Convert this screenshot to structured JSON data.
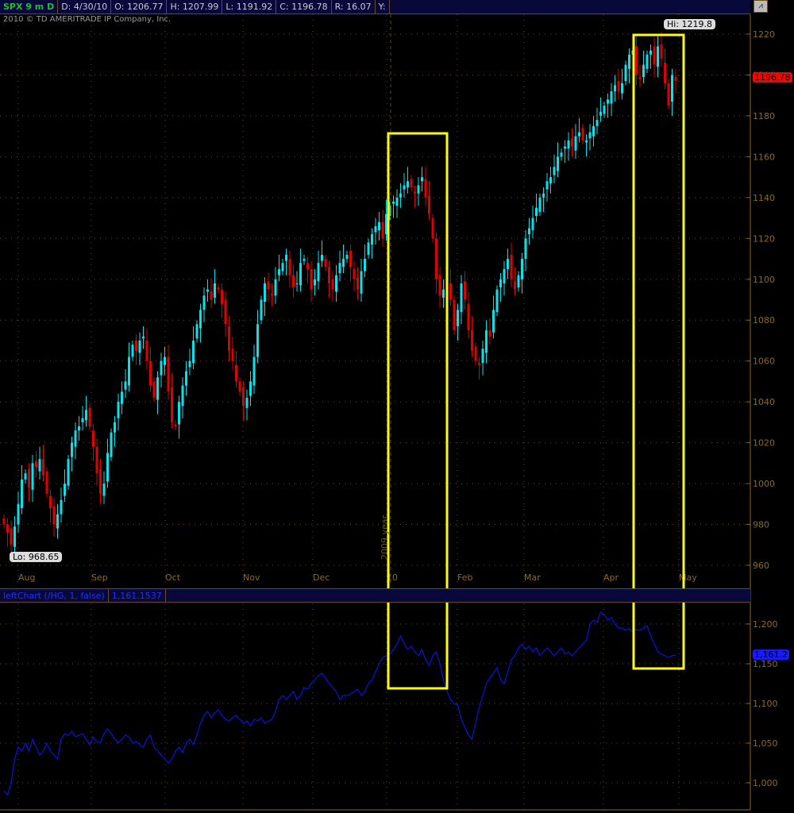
{
  "header": {
    "symbol": "SPX 9 m D",
    "date": "D: 4/30/10",
    "open": "O: 1206.77",
    "high": "H: 1207.99",
    "low": "L: 1191.92",
    "close": "C: 1196.78",
    "range": "R: 16.07",
    "y": "Y:"
  },
  "copyright": "2010 © TD AMERITRADE IP Company, Inc.",
  "chart_icon": "chart-style-icon",
  "lower_header": {
    "study": "leftChart (/HG, 1, false)",
    "value": "1,161.1537"
  },
  "labels": {
    "hi": "Hi: 1219.8",
    "lo": "Lo: 968.65",
    "last": "1196.78",
    "lower_last": "1,161.2",
    "year_marker": "2009 year"
  },
  "colors": {
    "up": "#00e5ee",
    "down": "#e00000",
    "line": "#1010e0",
    "highlight": "#ffff00"
  },
  "chart_data": [
    {
      "type": "candlestick",
      "title": "SPX 9 m D",
      "ylim": [
        960,
        1220
      ],
      "yticks": [
        960,
        980,
        1000,
        1020,
        1040,
        1060,
        1080,
        1100,
        1120,
        1140,
        1160,
        1180,
        1200,
        1220
      ],
      "xticks": [
        "Aug",
        "Sep",
        "Oct",
        "Nov",
        "Dec",
        "10",
        "Feb",
        "Mar",
        "Apr",
        "May"
      ],
      "closes": [
        980,
        976,
        970,
        979,
        990,
        1002,
        1005,
        998,
        1010,
        1008,
        1012,
        1004,
        995,
        988,
        980,
        985,
        992,
        1000,
        1012,
        1020,
        1026,
        1028,
        1032,
        1036,
        1028,
        1018,
        1005,
        995,
        1000,
        1015,
        1025,
        1030,
        1040,
        1045,
        1050,
        1062,
        1068,
        1065,
        1070,
        1072,
        1060,
        1048,
        1042,
        1052,
        1060,
        1062,
        1045,
        1030,
        1028,
        1040,
        1048,
        1055,
        1060,
        1070,
        1078,
        1085,
        1092,
        1095,
        1090,
        1098,
        1095,
        1088,
        1078,
        1065,
        1060,
        1050,
        1045,
        1038,
        1042,
        1050,
        1062,
        1078,
        1090,
        1098,
        1095,
        1092,
        1100,
        1105,
        1108,
        1112,
        1102,
        1096,
        1098,
        1108,
        1110,
        1105,
        1095,
        1100,
        1108,
        1112,
        1106,
        1098,
        1095,
        1102,
        1108,
        1110,
        1112,
        1106,
        1100,
        1095,
        1104,
        1110,
        1118,
        1122,
        1126,
        1128,
        1120,
        1132,
        1136,
        1138,
        1140,
        1142,
        1146,
        1148,
        1145,
        1142,
        1146,
        1150,
        1140,
        1132,
        1120,
        1100,
        1092,
        1095,
        1100,
        1090,
        1075,
        1085,
        1098,
        1090,
        1075,
        1065,
        1060,
        1058,
        1066,
        1075,
        1072,
        1085,
        1095,
        1100,
        1105,
        1110,
        1100,
        1095,
        1102,
        1110,
        1120,
        1125,
        1130,
        1135,
        1140,
        1142,
        1148,
        1150,
        1155,
        1160,
        1162,
        1165,
        1168,
        1165,
        1170,
        1172,
        1168,
        1168,
        1172,
        1175,
        1178,
        1182,
        1185,
        1188,
        1192,
        1195,
        1192,
        1196,
        1205,
        1210,
        1212,
        1200,
        1198,
        1205,
        1210,
        1212,
        1205,
        1214,
        1208,
        1196,
        1185,
        1200,
        1197
      ]
    },
    {
      "type": "line",
      "title": "leftChart (/HG, 1, false)",
      "ylim": [
        985,
        1220
      ],
      "yticks": [
        "1,000",
        "1,050",
        "1,100",
        "1,150",
        "1,200"
      ],
      "ytick_values": [
        1000,
        1050,
        1100,
        1150,
        1200
      ],
      "values": [
        990,
        985,
        1000,
        1030,
        1045,
        1040,
        1050,
        1040,
        1055,
        1045,
        1035,
        1040,
        1050,
        1040,
        1035,
        1030,
        1055,
        1062,
        1060,
        1065,
        1058,
        1060,
        1062,
        1055,
        1048,
        1058,
        1052,
        1050,
        1062,
        1068,
        1062,
        1055,
        1050,
        1055,
        1060,
        1058,
        1050,
        1052,
        1048,
        1045,
        1055,
        1060,
        1045,
        1040,
        1035,
        1030,
        1025,
        1030,
        1040,
        1045,
        1038,
        1050,
        1055,
        1048,
        1060,
        1075,
        1085,
        1090,
        1082,
        1088,
        1092,
        1085,
        1080,
        1078,
        1082,
        1085,
        1080,
        1075,
        1078,
        1072,
        1080,
        1078,
        1082,
        1075,
        1078,
        1080,
        1090,
        1105,
        1110,
        1105,
        1110,
        1115,
        1105,
        1110,
        1120,
        1118,
        1125,
        1130,
        1135,
        1138,
        1132,
        1125,
        1120,
        1115,
        1105,
        1110,
        1110,
        1112,
        1115,
        1118,
        1110,
        1115,
        1125,
        1130,
        1140,
        1150,
        1158,
        1160,
        1162,
        1168,
        1175,
        1185,
        1175,
        1168,
        1172,
        1165,
        1160,
        1168,
        1155,
        1148,
        1160,
        1165,
        1150,
        1130,
        1115,
        1105,
        1100,
        1098,
        1080,
        1070,
        1060,
        1055,
        1075,
        1095,
        1110,
        1125,
        1132,
        1138,
        1145,
        1130,
        1125,
        1140,
        1155,
        1160,
        1170,
        1175,
        1168,
        1172,
        1165,
        1170,
        1160,
        1165,
        1170,
        1165,
        1160,
        1165,
        1170,
        1162,
        1165,
        1160,
        1165,
        1170,
        1175,
        1180,
        1200,
        1205,
        1202,
        1215,
        1212,
        1205,
        1208,
        1200,
        1195,
        1195,
        1192,
        1194,
        1190,
        1193,
        1192,
        1195,
        1198,
        1185,
        1175,
        1165,
        1162,
        1160,
        1158,
        1160,
        1161
      ]
    }
  ]
}
